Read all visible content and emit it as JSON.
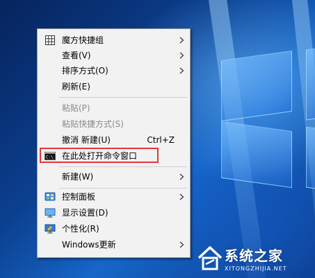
{
  "menu": {
    "items": [
      {
        "label": "魔方快捷组",
        "icon": "grid-icon",
        "submenu": true
      },
      {
        "label": "查看(V)",
        "submenu": true
      },
      {
        "label": "排序方式(O)",
        "submenu": true
      },
      {
        "label": "刷新(E)"
      },
      {
        "label": "粘贴(P)",
        "disabled": true
      },
      {
        "label": "粘贴快捷方式(S)",
        "disabled": true
      },
      {
        "label": "撤消 新建(U)",
        "shortcut": "Ctrl+Z"
      },
      {
        "label": "在此处打开命令窗口",
        "icon": "command-prompt-icon"
      },
      {
        "label": "新建(W)",
        "submenu": true
      },
      {
        "label": "控制面板",
        "icon": "control-panel-icon",
        "submenu": true
      },
      {
        "label": "显示设置(D)",
        "icon": "display-icon"
      },
      {
        "label": "个性化(R)",
        "icon": "personalize-icon"
      },
      {
        "label": "Windows更新",
        "submenu": true
      }
    ]
  },
  "watermark": {
    "title": "系统之家",
    "subtitle": "XITONGZHIJIA.NET"
  },
  "colors": {
    "menu_bg": "#f2f2f2",
    "highlight": "#e3353a",
    "disabled_text": "#8a8a8a"
  }
}
